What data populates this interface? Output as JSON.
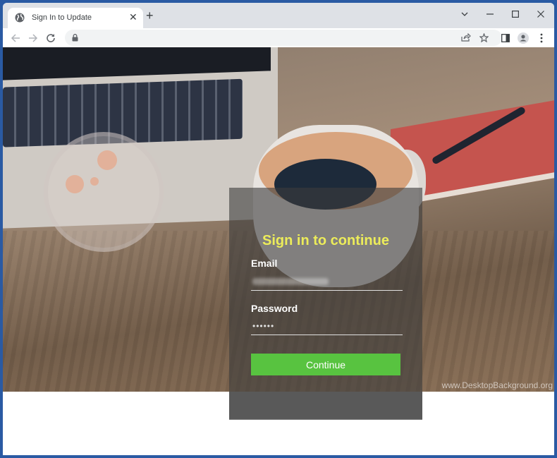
{
  "browser": {
    "tab_title": "Sign In to Update",
    "tab_close_icon": "close-icon",
    "new_tab_icon": "plus-icon",
    "window_controls": [
      "chevron-down-icon",
      "minimize-icon",
      "maximize-icon",
      "close-icon"
    ],
    "address_bar": {
      "url": "",
      "lock_icon": "lock-icon"
    },
    "toolbar_icons": [
      "share-icon",
      "star-icon",
      "side-panel-icon",
      "profile-icon",
      "menu-icon"
    ]
  },
  "page": {
    "background_credit": "www.DesktopBackground.org",
    "form": {
      "title": "Sign in to continue",
      "email_label": "Email",
      "email_value": "",
      "password_label": "Password",
      "password_value": "••••••",
      "submit_label": "Continue"
    }
  },
  "colors": {
    "title": "#ecec5a",
    "button": "#58c340",
    "window_frame": "#2a5aa3"
  }
}
